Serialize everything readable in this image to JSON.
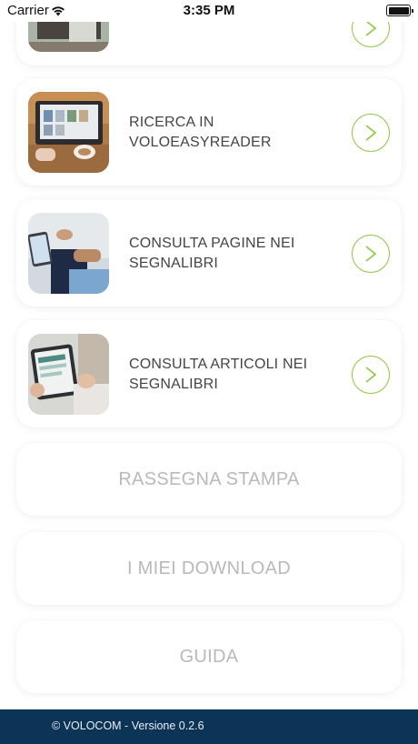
{
  "status_bar": {
    "carrier": "Carrier",
    "time": "3:35 PM"
  },
  "menu": {
    "items": [
      {
        "label": "",
        "icon": "chevron-right-icon"
      },
      {
        "label": "RICERCA IN VOLOEASYREADER",
        "icon": "chevron-right-icon"
      },
      {
        "label": "CONSULTA PAGINE NEI SEGNALIBRI",
        "icon": "chevron-right-icon"
      },
      {
        "label": "CONSULTA ARTICOLI NEI SEGNALIBRI",
        "icon": "chevron-right-icon"
      }
    ],
    "buttons": {
      "rassegna": "RASSEGNA STAMPA",
      "downloads": "I MIEI DOWNLOAD",
      "guida": "GUIDA"
    }
  },
  "footer": {
    "text": "© VOLOCOM - Versione 0.2.6"
  },
  "colors": {
    "accent": "#8cc63f",
    "footer_bg": "#0c3456",
    "button_text": "#b9b9b9"
  }
}
